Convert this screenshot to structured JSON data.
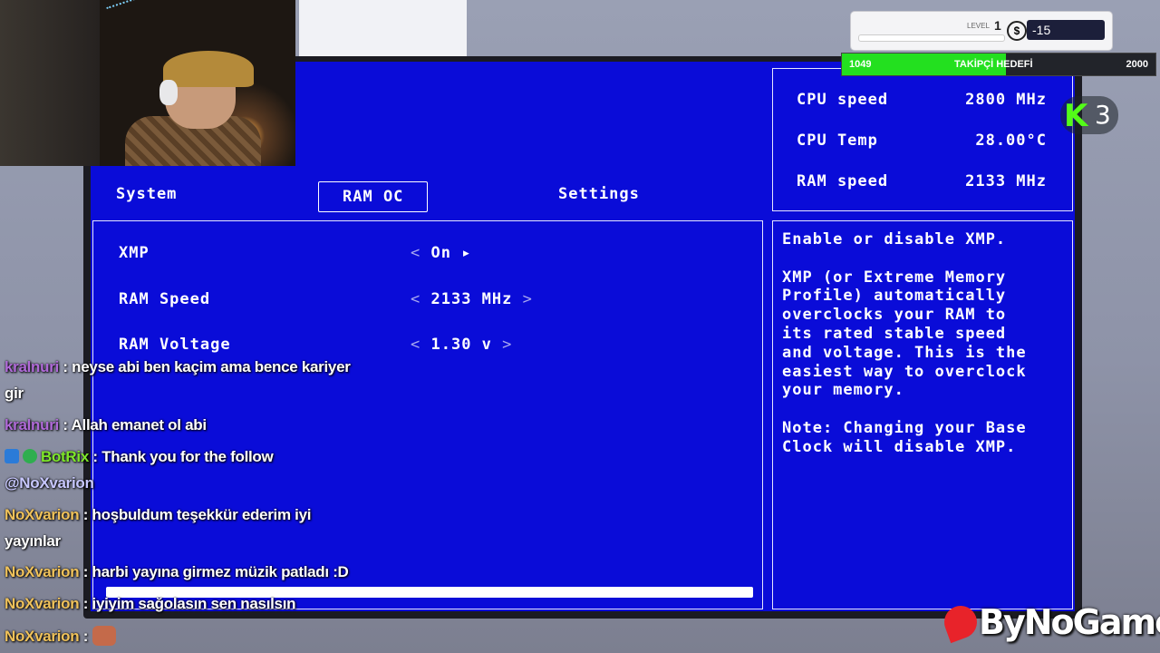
{
  "bios": {
    "tabs": [
      {
        "label": "System"
      },
      {
        "label": "RAM OC"
      },
      {
        "label": "Settings"
      }
    ],
    "settings": [
      {
        "label": "XMP",
        "value": "On",
        "left_arrow": "<",
        "right_arrow": "▸"
      },
      {
        "label": "RAM Speed",
        "value": "2133 MHz",
        "left_arrow": "<",
        "right_arrow": ">"
      },
      {
        "label": "RAM Voltage",
        "value": "1.30 v",
        "left_arrow": "<",
        "right_arrow": ">"
      }
    ],
    "stats": [
      {
        "label": "CPU speed",
        "value": "2800 MHz"
      },
      {
        "label": "CPU Temp",
        "value": "28.00°C"
      },
      {
        "label": "RAM speed",
        "value": "2133 MHz"
      }
    ],
    "help_text": "Enable or disable XMP.\n\nXMP (or Extreme Memory\nProfile) automatically\noverclocks your RAM to\nits rated stable speed\nand voltage. This is the\neasiest way to overclock\nyour memory.\n\nNote: Changing your Base\nClock will disable XMP."
  },
  "overlay": {
    "level_label": "LEVEL",
    "level": "1",
    "coin_symbol": "$",
    "money": "-15",
    "goal_current": "1049",
    "goal_title": "TAKİPÇİ HEDEFİ",
    "goal_max": "2000",
    "goal_progress": 0.5245,
    "kick_letter": "K",
    "kick_count": "3"
  },
  "chat": [
    {
      "user": "kralnuri",
      "color": "#b06ad8",
      "text": " : neyse abi ben kaçim ama bence kariyer"
    },
    {
      "user": "",
      "color": "#ffffff",
      "text": "gir"
    },
    {
      "user": "kralnuri",
      "color": "#b06ad8",
      "text": " : Allah emanet ol abi"
    },
    {
      "user": "BotRix",
      "color": "#7ee62a",
      "text": " : Thank you for the follow"
    },
    {
      "user": "",
      "color": "#c8c8ff",
      "text": "@NoXvarion"
    },
    {
      "user": "NoXvarion",
      "color": "#f0c25a",
      "text": " : hoşbuldum teşekkür ederim iyi"
    },
    {
      "user": "",
      "color": "#ffffff",
      "text": "yayınlar"
    },
    {
      "user": "NoXvarion",
      "color": "#f0c25a",
      "text": " : harbi yayına girmez müzik patladı :D"
    },
    {
      "user": "NoXvarion",
      "color": "#f0c25a",
      "text": " : iyiyim sağolasın sen nasılsın"
    },
    {
      "user": "NoXvarion",
      "color": "#f0c25a",
      "text": " : "
    }
  ],
  "brand": {
    "logo_text": "ByNoGame"
  },
  "colors": {
    "bios_bg": "#0a0cd8",
    "kick_green": "#53fc18",
    "goal_green": "#23e01f"
  }
}
